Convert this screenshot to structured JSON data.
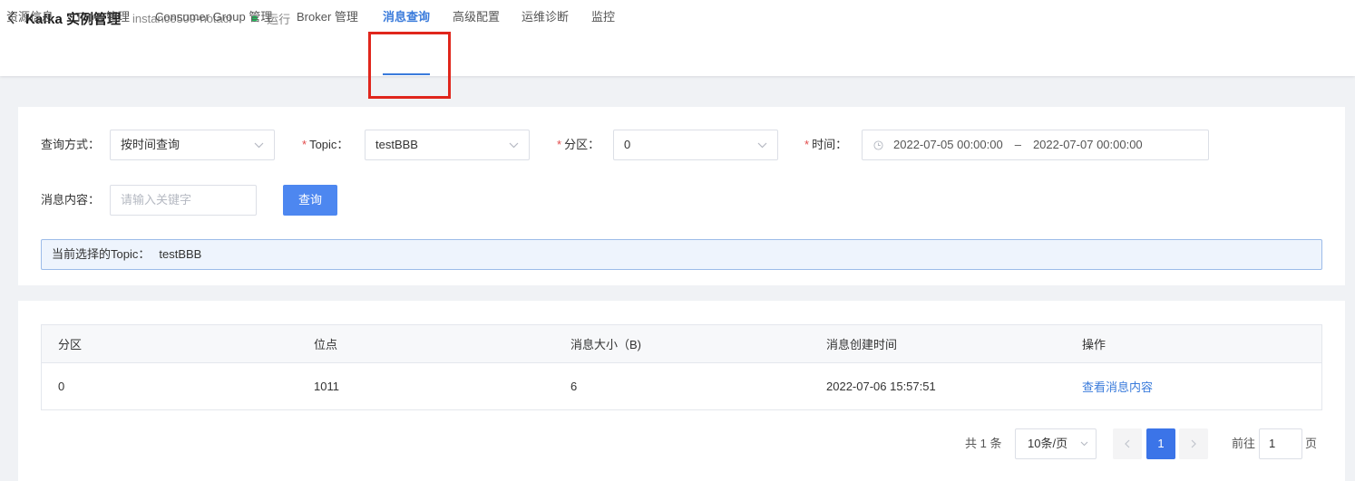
{
  "header": {
    "title": "Kafka 实例管理",
    "instance_name": "instance509-notacl",
    "status": "运行",
    "status_color": "#22c55e"
  },
  "tabs": [
    {
      "label": "资源信息"
    },
    {
      "label": "Topic 管理"
    },
    {
      "label": "Consumer Group 管理"
    },
    {
      "label": "Broker 管理"
    },
    {
      "label": "消息查询",
      "active": true
    },
    {
      "label": "高级配置"
    },
    {
      "label": "运维诊断"
    },
    {
      "label": "监控"
    }
  ],
  "query_form": {
    "method_label": "查询方式：",
    "method_value": "按时间查询",
    "topic_label": "Topic：",
    "topic_value": "testBBB",
    "partition_label": "分区：",
    "partition_value": "0",
    "time_label": "时间：",
    "time_start": "2022-07-05 00:00:00",
    "time_separator": "–",
    "time_end": "2022-07-07 00:00:00",
    "content_label": "消息内容：",
    "content_placeholder": "请输入关键字",
    "query_button": "查询",
    "required_mark": "*"
  },
  "selected_topic_banner": {
    "label": "当前选择的Topic：",
    "value": "testBBB"
  },
  "table": {
    "columns": [
      "分区",
      "位点",
      "消息大小（B)",
      "消息创建时间",
      "操作"
    ],
    "rows": [
      {
        "partition": "0",
        "offset": "1011",
        "size": "6",
        "created": "2022-07-06 15:57:51",
        "action": "查看消息内容"
      }
    ]
  },
  "pagination": {
    "total": "共 1 条",
    "page_size": "10条/页",
    "current_page": "1",
    "goto_label": "前往",
    "goto_value": "1",
    "page_suffix": "页"
  },
  "colors": {
    "accent": "#3a7bdb",
    "highlight_box": "#e0261c",
    "required": "#e24a4a"
  },
  "icons": [
    "back-chevron-icon",
    "status-dot",
    "chevron-down-icon",
    "clock-icon",
    "chevron-left-icon",
    "chevron-right-icon"
  ]
}
